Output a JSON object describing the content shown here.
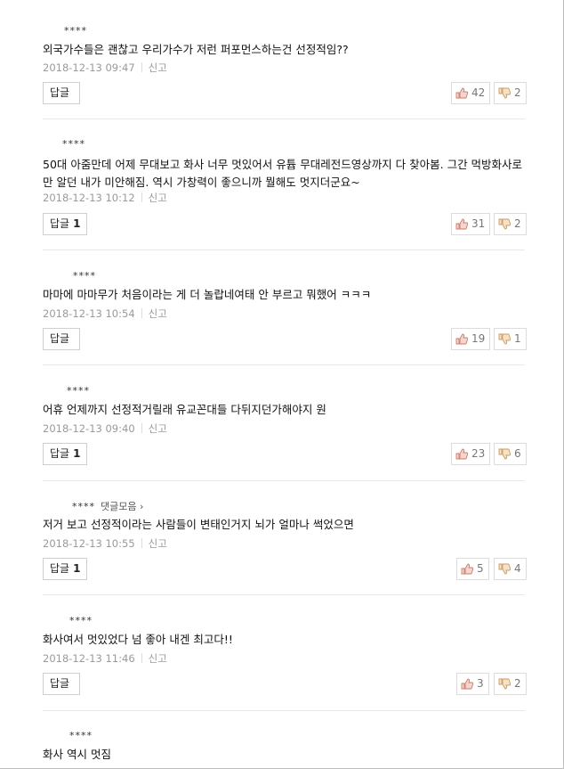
{
  "labels": {
    "report": "신고",
    "reply": "답글"
  },
  "comments": [
    {
      "author": "****",
      "text": "외국가수들은 괜찮고 우리가수가 저런 퍼포먼스하는건 선정적임??",
      "time": "2018-12-13 09:47",
      "reply_count": "",
      "likes": "42",
      "dislikes": "2"
    },
    {
      "author": "****",
      "text": "50대 아줌만데 어제 무대보고 화사 너무 멋있어서 유튭 무대레전드영상까지 다 찾아봄. 그간 먹방화사로만 알던 내가 미안해짐. 역시 가창력이 좋으니까 뭘해도 멋지더군요~",
      "time": "2018-12-13 10:12",
      "reply_count": "1",
      "likes": "31",
      "dislikes": "2"
    },
    {
      "author": "****",
      "text": "마마에 마마무가 처음이라는 게 더 놀랍네여태 안 부르고 뭐했어 ㅋㅋㅋ",
      "time": "2018-12-13 10:54",
      "reply_count": "",
      "likes": "19",
      "dislikes": "1"
    },
    {
      "author": "****",
      "text": "어휴 언제까지 선정적거릴래 유교꼰대들 다뒤지던가해야지 원",
      "time": "2018-12-13 09:40",
      "reply_count": "1",
      "likes": "23",
      "dislikes": "6"
    },
    {
      "author": "****",
      "more": "댓글모음 ›",
      "text": "저거 보고 선정적이라는 사람들이 변태인거지 뇌가 얼마나 썩었으면",
      "time": "2018-12-13 10:55",
      "reply_count": "1",
      "likes": "5",
      "dislikes": "4"
    },
    {
      "author": "****",
      "text": "화사여서 멋있었다 넘 좋아 내겐 최고다!!",
      "time": "2018-12-13 11:46",
      "reply_count": "",
      "likes": "3",
      "dislikes": "2"
    },
    {
      "author": "****",
      "text": "화사 역시 멋짐"
    }
  ]
}
